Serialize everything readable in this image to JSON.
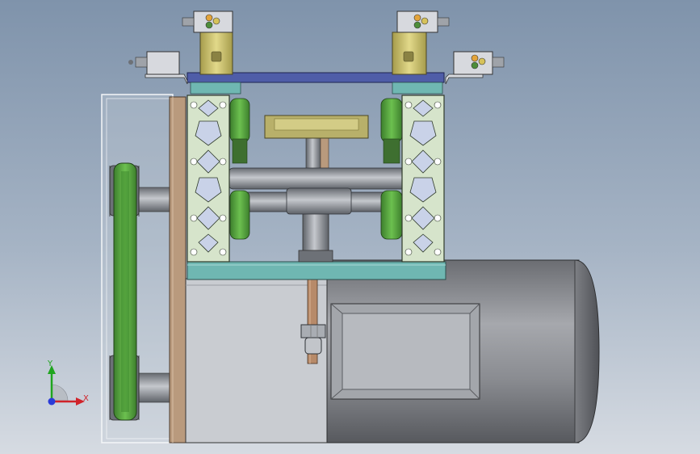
{
  "triad": {
    "x_label": "X",
    "y_label": "Y"
  },
  "colors": {
    "background_top": "#7f93ab",
    "background_bottom": "#d6dbe2",
    "belt_green": "#4f9a3c",
    "extrusion_green": "#d6e4cb",
    "cover_plate": "#4f5da8",
    "base_plate": "#6fb7b2",
    "sensor_body": "#c8be6a",
    "cam_bar": "#b8b06a",
    "copper_plate": "#b99a7d",
    "motor_body": "#8b8d91"
  },
  "icons": [
    "coordinate-triad-icon"
  ]
}
